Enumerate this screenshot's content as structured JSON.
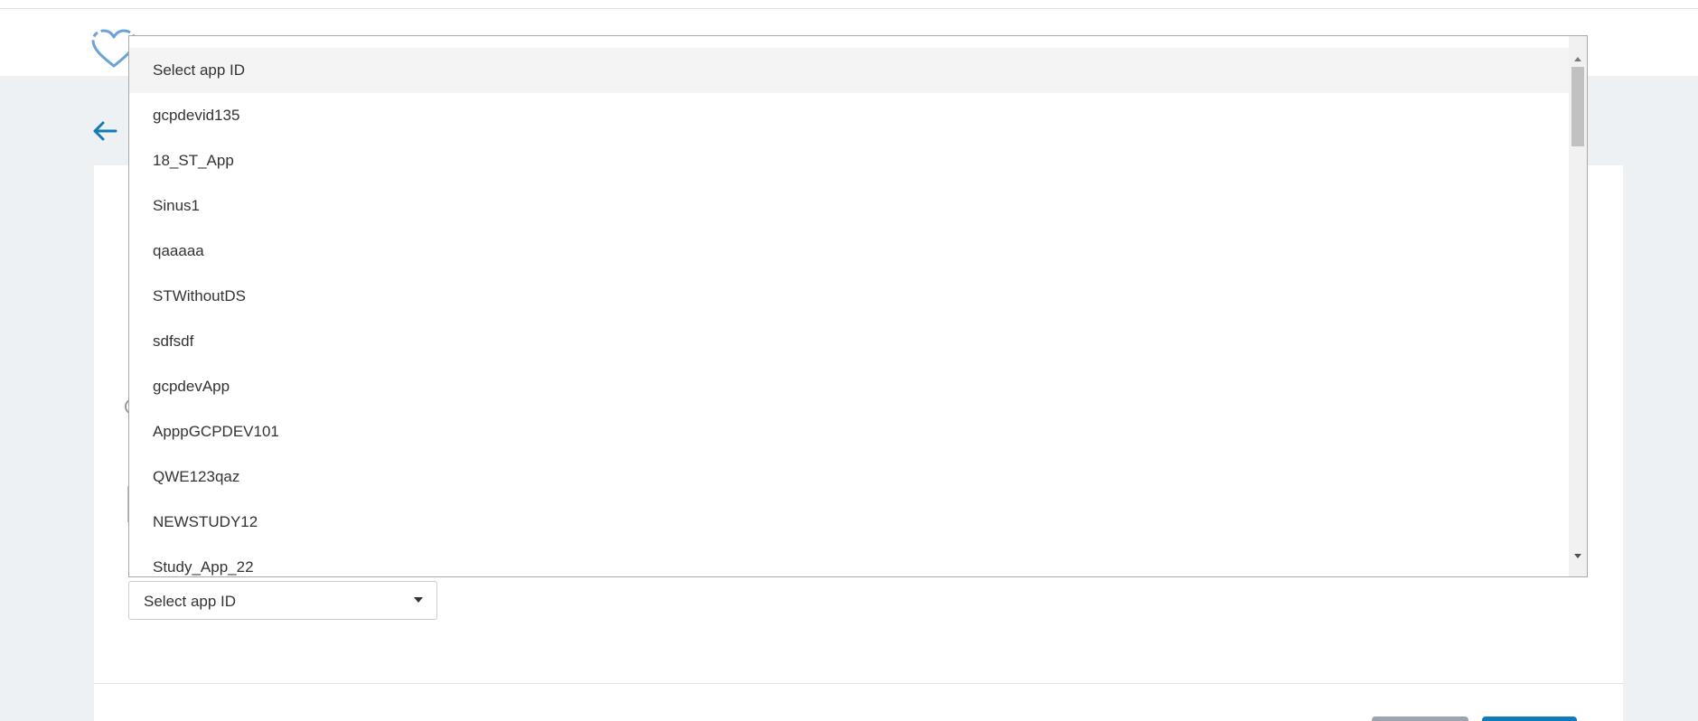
{
  "header": {
    "logo_icon": "heart-outline-icon"
  },
  "nav": {
    "back_icon": "arrow-left-icon"
  },
  "app_select": {
    "value": "Select app ID",
    "caret_icon": "caret-down-icon"
  },
  "dropdown": {
    "options": [
      {
        "label": "Select app ID",
        "selected": true
      },
      {
        "label": "gcpdevid135"
      },
      {
        "label": "18_ST_App"
      },
      {
        "label": "Sinus1"
      },
      {
        "label": "qaaaaa"
      },
      {
        "label": "STWithoutDS"
      },
      {
        "label": "sdfsdf"
      },
      {
        "label": "gcpdevApp"
      },
      {
        "label": "ApppGCPDEV101"
      },
      {
        "label": "QWE123qaz"
      },
      {
        "label": "NEWSTUDY12"
      },
      {
        "label": "Study_App_22"
      }
    ]
  },
  "colors": {
    "accent": "#1479b8",
    "alert_edge": "#e55353",
    "page_background": "#eef1f4"
  }
}
